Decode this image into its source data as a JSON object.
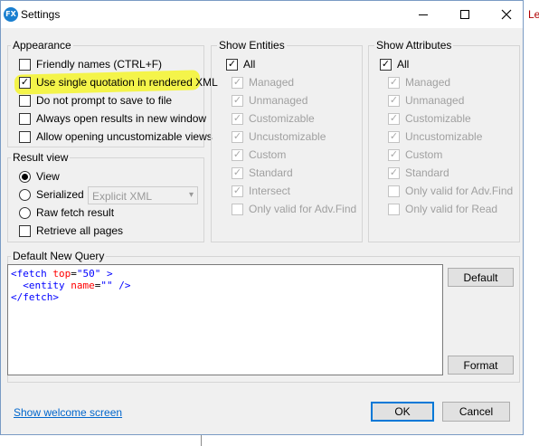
{
  "background": {
    "partial_text": "Le"
  },
  "window": {
    "title": "Settings",
    "icon": "app-logo-icon",
    "icon_glyph": "FX"
  },
  "appearance": {
    "title": "Appearance",
    "options": [
      {
        "label": "Friendly names (CTRL+F)",
        "checked": false
      },
      {
        "label": "Use single quotation in rendered XML",
        "checked": true,
        "highlighted": true
      },
      {
        "label": "Do not prompt to save to file",
        "checked": false
      },
      {
        "label": "Always open results in new window",
        "checked": false
      },
      {
        "label": "Allow opening uncustomizable views",
        "checked": false
      }
    ]
  },
  "result_view": {
    "title": "Result view",
    "view": {
      "label": "View",
      "selected": true
    },
    "serialized": {
      "label": "Serialized",
      "selected": false,
      "format": "Explicit XML"
    },
    "raw": {
      "label": "Raw fetch result",
      "selected": false
    },
    "retrieve_all": {
      "label": "Retrieve all pages",
      "checked": false
    }
  },
  "show_entities": {
    "title": "Show Entities",
    "all": {
      "label": "All",
      "checked": true
    },
    "options": [
      {
        "label": "Managed",
        "checked": true
      },
      {
        "label": "Unmanaged",
        "checked": true
      },
      {
        "label": "Customizable",
        "checked": true
      },
      {
        "label": "Uncustomizable",
        "checked": true
      },
      {
        "label": "Custom",
        "checked": true
      },
      {
        "label": "Standard",
        "checked": true
      },
      {
        "label": "Intersect",
        "checked": true
      },
      {
        "label": "Only valid for Adv.Find",
        "checked": false
      }
    ]
  },
  "show_attributes": {
    "title": "Show Attributes",
    "all": {
      "label": "All",
      "checked": true
    },
    "options": [
      {
        "label": "Managed",
        "checked": true
      },
      {
        "label": "Unmanaged",
        "checked": true
      },
      {
        "label": "Customizable",
        "checked": true
      },
      {
        "label": "Uncustomizable",
        "checked": true
      },
      {
        "label": "Custom",
        "checked": true
      },
      {
        "label": "Standard",
        "checked": true
      },
      {
        "label": "Only valid for Adv.Find",
        "checked": false
      },
      {
        "label": "Only valid for Read",
        "checked": false
      }
    ]
  },
  "default_query": {
    "title": "Default New Query",
    "line1": {
      "open": "<fetch ",
      "attr": "top",
      "eq": "=",
      "value": "\"50\"",
      "close": " >"
    },
    "line2": {
      "open": "<entity ",
      "attr": "name",
      "eq": "=",
      "value": "\"\"",
      "close": " />"
    },
    "line3": {
      "text": "</fetch>"
    },
    "default_button": "Default",
    "format_button": "Format"
  },
  "footer": {
    "welcome_link": "Show welcome screen",
    "ok": "OK",
    "cancel": "Cancel"
  },
  "colors": {
    "highlight": "#f4f44a",
    "xml_tag": "#0000ff",
    "xml_attr": "#ff0000",
    "link": "#0066cc",
    "primary_border": "#0078d7"
  }
}
